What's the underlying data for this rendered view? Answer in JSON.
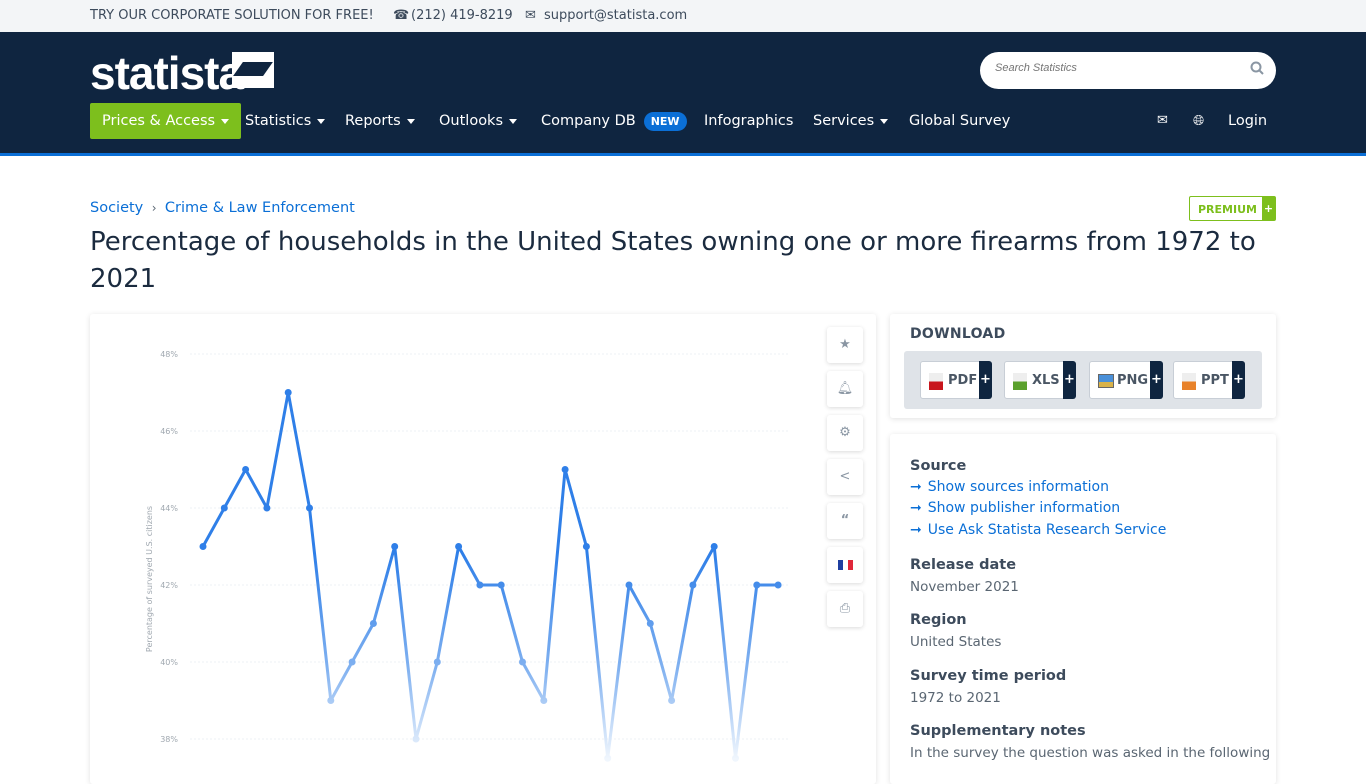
{
  "topbar": {
    "promo": "TRY OUR CORPORATE SOLUTION FOR FREE!",
    "phone": "(212) 419-8219",
    "email": "support@statista.com"
  },
  "header": {
    "logo": "statista",
    "search_placeholder": "Search Statistics",
    "nav": [
      {
        "label": "Prices & Access",
        "dropdown": true
      },
      {
        "label": "Statistics",
        "dropdown": true
      },
      {
        "label": "Reports",
        "dropdown": true
      },
      {
        "label": "Outlooks",
        "dropdown": true
      },
      {
        "label": "Company DB",
        "badge": "NEW"
      },
      {
        "label": "Infographics"
      },
      {
        "label": "Services",
        "dropdown": true
      },
      {
        "label": "Global Survey"
      }
    ],
    "login": "Login",
    "accent": "#7dbf1d",
    "navy": "#0f2540"
  },
  "breadcrumb": [
    "Society",
    "Crime & Law Enforcement"
  ],
  "premium": "PREMIUM",
  "title": "Percentage of households in the United States owning one or more firearms from 1972 to 2021",
  "tools": [
    "star-icon",
    "bell-icon",
    "gear-icon",
    "share-icon",
    "quote-icon",
    "french-flag-icon",
    "print-icon"
  ],
  "download": {
    "title": "DOWNLOAD",
    "buttons": [
      "PDF",
      "XLS",
      "PNG",
      "PPT"
    ]
  },
  "info": {
    "source_label": "Source",
    "links": [
      "Show sources information",
      "Show publisher information",
      "Use Ask Statista Research Service"
    ],
    "release_label": "Release date",
    "release": "November 2021",
    "region_label": "Region",
    "region": "United States",
    "period_label": "Survey time period",
    "period": "1972 to 2021",
    "notes_label": "Supplementary notes",
    "notes": "In the survey the question was asked in the following"
  },
  "chart_data": {
    "type": "line",
    "ylabel": "Percentage of surveyed U.S. citizens",
    "yticks": [
      "48%",
      "46%",
      "44%",
      "42%",
      "40%",
      "38%"
    ],
    "ylim": [
      37,
      48
    ],
    "grid": true,
    "color": "#2f7fe8",
    "values": [
      43,
      44,
      45,
      44,
      47,
      44,
      39,
      40,
      41,
      43,
      38,
      40,
      43,
      42,
      42,
      40,
      39,
      45,
      43,
      37.5,
      42,
      41,
      39,
      42,
      43,
      37.5,
      42,
      42
    ]
  }
}
